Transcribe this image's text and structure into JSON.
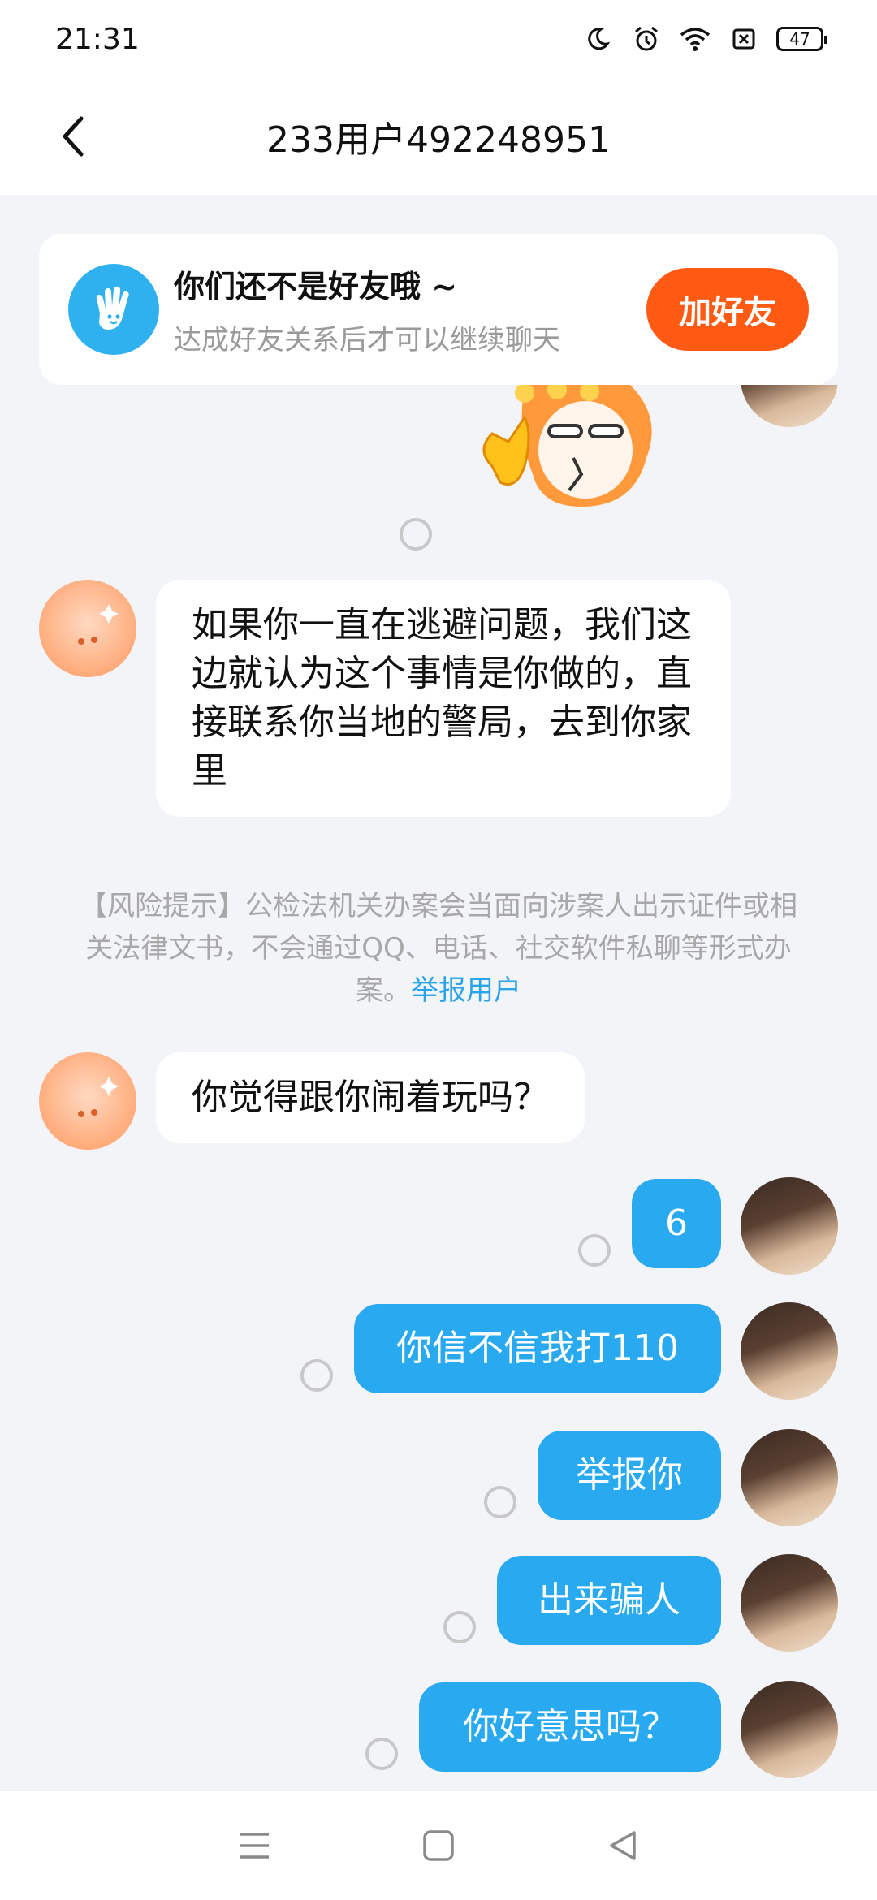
{
  "status_bar": {
    "time": "21:31",
    "battery": "47",
    "icons": [
      "moon-icon",
      "alarm-icon",
      "wifi-icon",
      "sim-off-icon",
      "battery-icon"
    ]
  },
  "header": {
    "title": "233用户492248951",
    "back_icon": "chevron-left-icon"
  },
  "friend_banner": {
    "title": "你们还不是好友哦 ~",
    "subtitle": "达成好友关系后才可以继续聊天",
    "button_label": "加好友",
    "button_color": "#ff5a14",
    "icon": "wave-hand-icon"
  },
  "messages": {
    "m1": "如果你一直在逃避问题，我们这边就认为这个事情是你做的，直接联系你当地的警局，去到你家里",
    "m2": "你觉得跟你闹着玩吗？",
    "m3": "6",
    "m4": "你信不信我打110",
    "m5": "举报你",
    "m6": "出来骗人",
    "m7": "你好意思吗？"
  },
  "risk_notice": {
    "text": "【风险提示】公检法机关办案会当面向涉案人出示证件或相关法律文书，不会通过QQ、电话、社交软件私聊等形式办案。",
    "link": "举报用户"
  },
  "colors": {
    "sent_bubble": "#29aaf0",
    "received_bubble": "#ffffff",
    "chat_background": "#f2f4f8",
    "link": "#2aa3ea"
  },
  "navbar": {
    "icons": [
      "menu-icon",
      "home-square-icon",
      "back-triangle-icon"
    ]
  }
}
